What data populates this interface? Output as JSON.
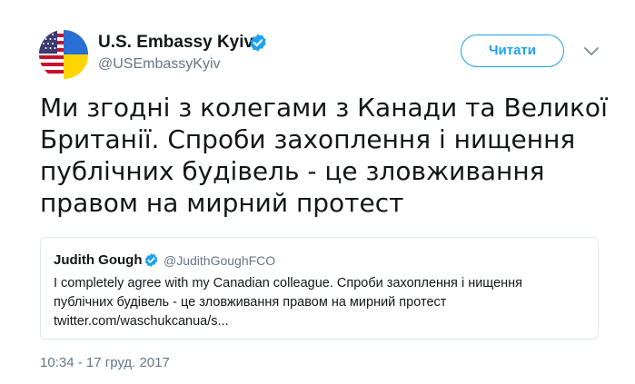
{
  "author": {
    "name": "U.S. Embassy Kyiv",
    "handle": "@USEmbassyKyiv",
    "avatar_icon": "us-ukraine-flag-avatar",
    "verified_color": "#1da1f2"
  },
  "follow_button": {
    "label": "Читати",
    "color": "#1da1f2"
  },
  "menu_icon": "chevron-down-icon",
  "tweet": {
    "lines": [
      "Ми згодні з колегами з Канади та Великої",
      "Британії. Спроби захоплення і нищення",
      "публічних будівель - це зловживання",
      "правом на мирний протест"
    ],
    "timestamp": "10:34 - 17 груд. 2017"
  },
  "quoted_tweet": {
    "name": "Judith Gough",
    "handle": "@JudithGoughFCO",
    "lines": [
      "I completely agree with my Canadian colleague.  Спроби захоплення і нищення",
      "публічних будівель - це зловживання правом на мирний протест",
      "twitter.com/waschukcanua/s..."
    ]
  }
}
